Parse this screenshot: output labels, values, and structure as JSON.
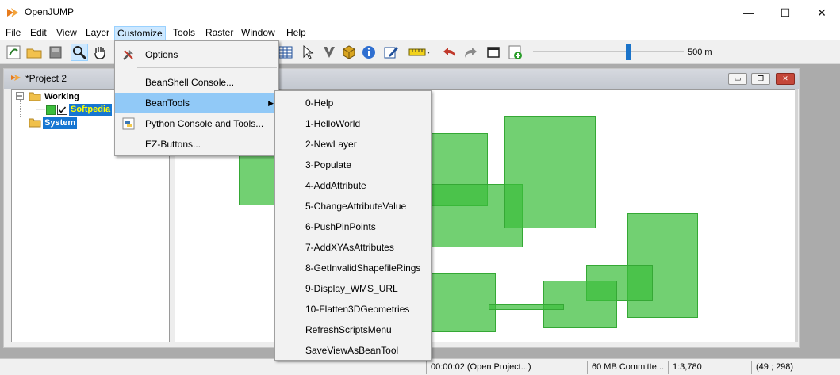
{
  "window": {
    "title": "OpenJUMP",
    "controls": {
      "minimize": "—",
      "maximize": "☐",
      "close": "✕"
    }
  },
  "menubar": {
    "items": [
      {
        "label": "File",
        "name": "file"
      },
      {
        "label": "Edit",
        "name": "edit"
      },
      {
        "label": "View",
        "name": "view"
      },
      {
        "label": "Layer",
        "name": "layer"
      },
      {
        "label": "Customize",
        "name": "customize",
        "active": true
      },
      {
        "label": "Tools",
        "name": "tools"
      },
      {
        "label": "Raster",
        "name": "raster"
      },
      {
        "label": "Window",
        "name": "window"
      },
      {
        "label": "Help",
        "name": "help"
      }
    ]
  },
  "toolbar": {
    "scale_label": "500 m",
    "icons": [
      "zoom-to-layer-icon",
      "open-folder-icon",
      "save-project-icon",
      "zoom-icon",
      "pan-hand-icon",
      "measure-table-icon",
      "select-arrow-icon",
      "cut-tool-icon",
      "box-3d-icon",
      "info-icon",
      "edit-pencil-icon",
      "ruler-icon",
      "undo-icon",
      "redo-icon",
      "window-icon",
      "add-layer-icon"
    ]
  },
  "project_frame": {
    "title": "*Project 2",
    "controls": {
      "minimize": "▭",
      "restore": "❐",
      "close": "✕"
    }
  },
  "layer_tree": {
    "categories": [
      {
        "label": "Working",
        "expanded": true,
        "layers": [
          {
            "label": "Softpedia",
            "checked": true,
            "color": "#3cbe3c"
          }
        ]
      },
      {
        "label": "System",
        "selected": true
      }
    ]
  },
  "customize_menu": {
    "items": [
      {
        "label": "Options",
        "mnemonic": "O",
        "icon": "tools-icon"
      },
      {
        "label": "BeanShell Console...",
        "mnemonic": "B"
      },
      {
        "label": "BeanTools",
        "mnemonic": "B",
        "highlighted": true,
        "submenu": true
      },
      {
        "label": "Python Console and Tools...",
        "mnemonic": "P",
        "icon": "python-icon"
      },
      {
        "label": "EZ-Buttons...",
        "mnemonic": "E"
      }
    ]
  },
  "beantools_menu": {
    "items": [
      "0-Help",
      "1-HelloWorld",
      "2-NewLayer",
      "3-Populate",
      "4-AddAttribute",
      "5-ChangeAttributeValue",
      "6-PushPinPoints",
      "7-AddXYAsAttributes",
      "8-GetInvalidShapefileRings",
      "9-Display_WMS_URL",
      "10-Flatten3DGeometries",
      "RefreshScriptsMenu",
      "SaveViewAsBeanTool"
    ]
  },
  "statusbar": {
    "time": "00:00:02 (Open Project...)",
    "memory": "60 MB Committe...",
    "scale": "1:3,780",
    "coords": "(49 ; 298)"
  },
  "colors": {
    "accent": "#1676d2",
    "menu_highlight": "#91c9f7",
    "feature_fill": "#3cbe3c"
  }
}
